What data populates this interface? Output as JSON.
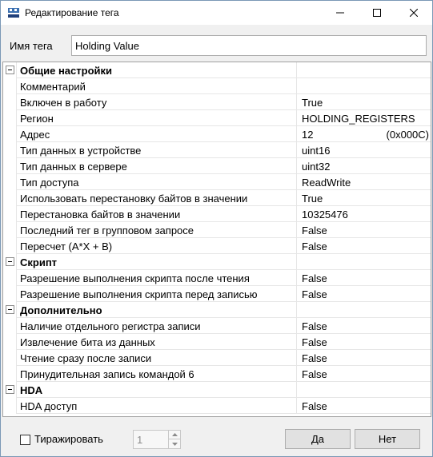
{
  "window": {
    "title": "Редактирование тега",
    "icons": {
      "app": "opc-app-icon",
      "minimize": "minimize-icon",
      "maximize": "maximize-icon",
      "close": "close-icon"
    }
  },
  "tag": {
    "label": "Имя тега",
    "value": "Holding Value"
  },
  "grid": {
    "rows": [
      {
        "type": "cat",
        "name": "Общие настройки",
        "value": ""
      },
      {
        "type": "prop",
        "name": "Комментарий",
        "value": ""
      },
      {
        "type": "prop",
        "name": "Включен в работу",
        "value": "True"
      },
      {
        "type": "prop",
        "name": "Регион",
        "value": "HOLDING_REGISTERS"
      },
      {
        "type": "prop",
        "name": "Адрес",
        "hint": "(0x000C)",
        "value": "12"
      },
      {
        "type": "prop",
        "name": "Тип данных в устройстве",
        "value": "uint16"
      },
      {
        "type": "prop",
        "name": "Тип данных в сервере",
        "value": "uint32"
      },
      {
        "type": "prop",
        "name": "Тип доступа",
        "value": "ReadWrite"
      },
      {
        "type": "prop",
        "name": "Использовать перестановку байтов в значении",
        "value": "True"
      },
      {
        "type": "prop",
        "name": "Перестановка байтов в значении",
        "value": "10325476"
      },
      {
        "type": "prop",
        "name": "Последний тег в групповом запросе",
        "value": "False"
      },
      {
        "type": "prop",
        "name": "Пересчет (A*X + B)",
        "value": "False"
      },
      {
        "type": "cat",
        "name": "Скрипт",
        "value": ""
      },
      {
        "type": "prop",
        "name": "Разрешение выполнения скрипта после чтения",
        "value": "False"
      },
      {
        "type": "prop",
        "name": "Разрешение выполнения скрипта перед записью",
        "value": "False"
      },
      {
        "type": "cat",
        "name": "Дополнительно",
        "value": ""
      },
      {
        "type": "prop",
        "name": "Наличие отдельного регистра записи",
        "value": "False"
      },
      {
        "type": "prop",
        "name": "Извлечение бита из данных",
        "value": "False"
      },
      {
        "type": "prop",
        "name": "Чтение сразу после записи",
        "value": "False"
      },
      {
        "type": "prop",
        "name": "Принудительная запись командой 6",
        "value": "False"
      },
      {
        "type": "cat",
        "name": "HDA",
        "value": ""
      },
      {
        "type": "prop",
        "name": "HDA доступ",
        "value": "False"
      }
    ]
  },
  "footer": {
    "replicate_label": "Тиражировать",
    "replicate_checked": false,
    "count_value": "1",
    "ok_label": "Да",
    "cancel_label": "Нет"
  }
}
